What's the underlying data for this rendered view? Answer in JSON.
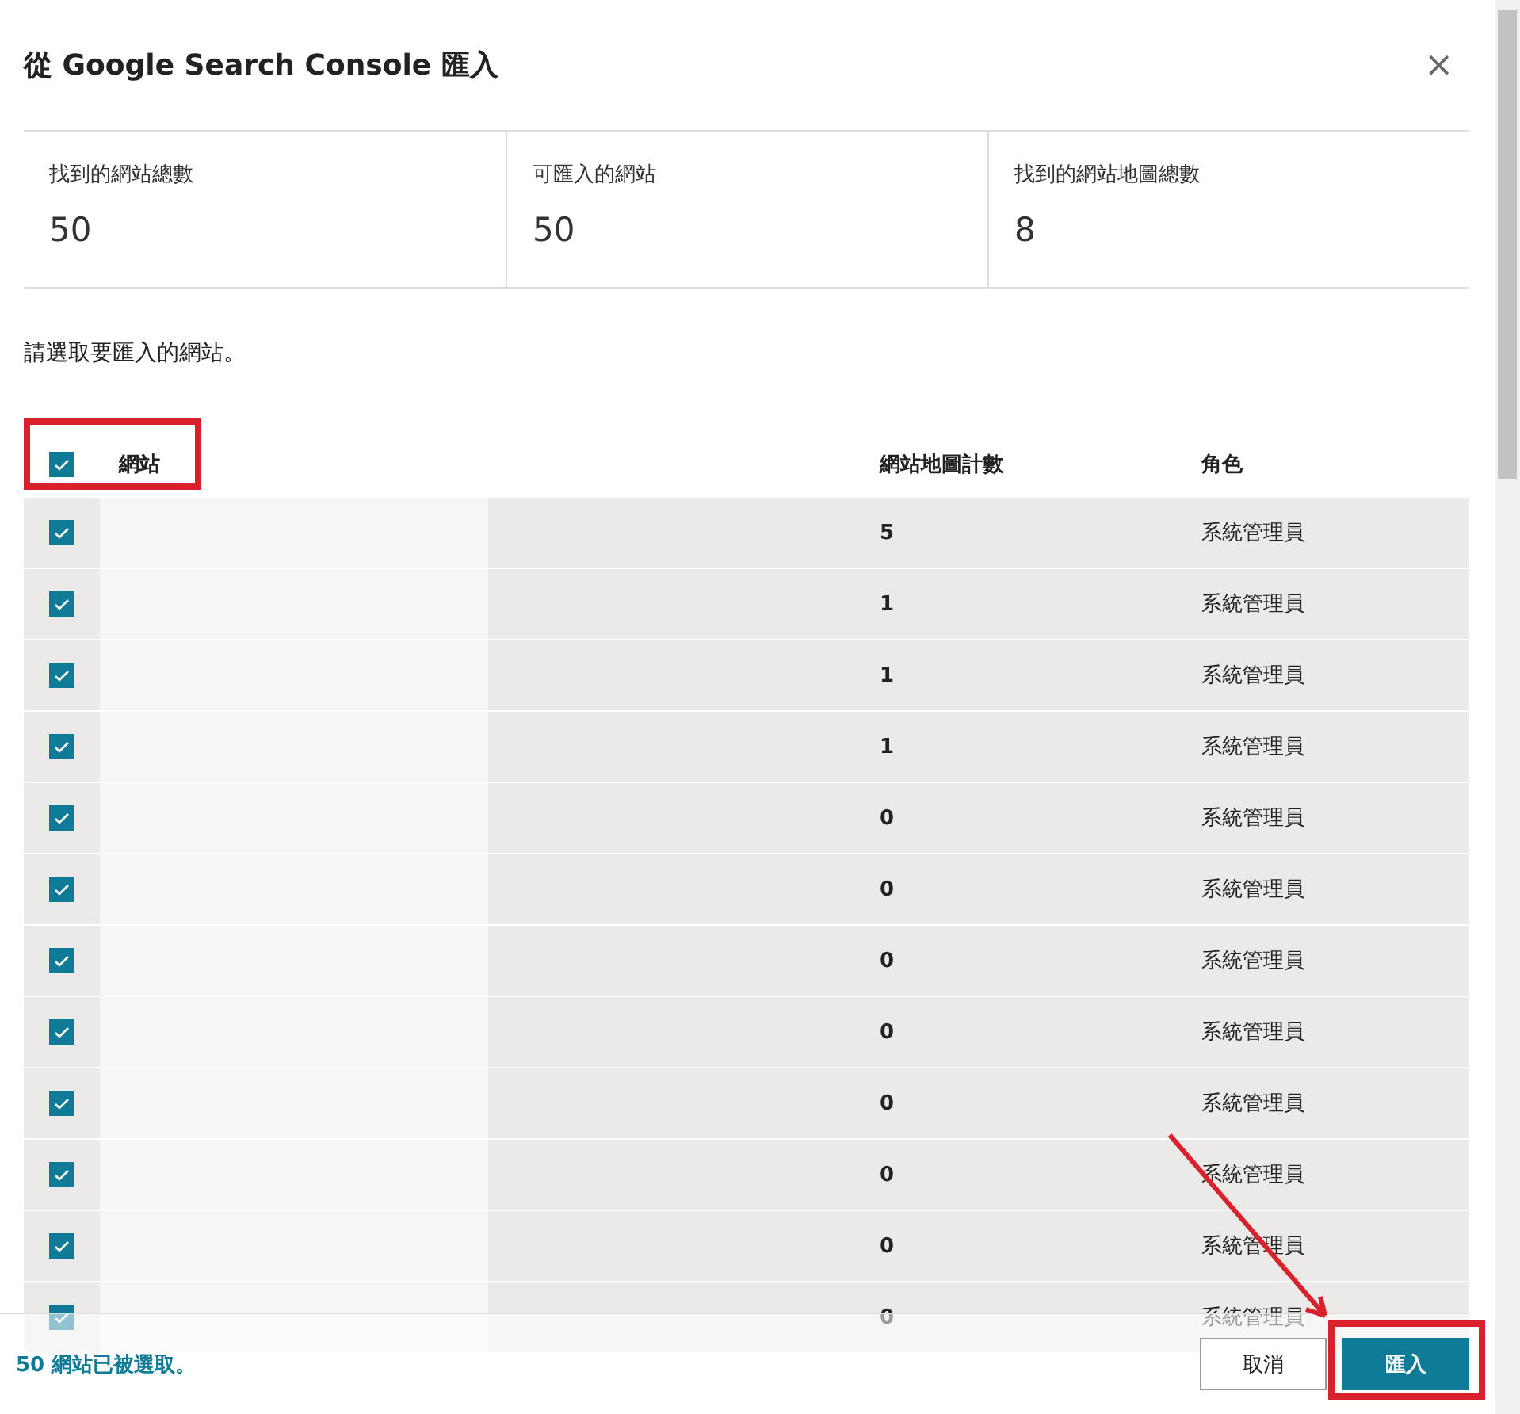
{
  "dialog": {
    "title": "從 Google Search Console 匯入",
    "close": "×"
  },
  "stats": [
    {
      "label": "找到的網站總數",
      "value": "50"
    },
    {
      "label": "可匯入的網站",
      "value": "50"
    },
    {
      "label": "找到的網站地圖總數",
      "value": "8"
    }
  ],
  "instruction": "請選取要匯入的網站。",
  "table": {
    "select_all": {
      "checked": true
    },
    "columns": [
      "網站",
      "網站地圖計數",
      "角色"
    ],
    "rows": [
      {
        "checked": true,
        "sitemaps": "5",
        "role": "系統管理員"
      },
      {
        "checked": true,
        "sitemaps": "1",
        "role": "系統管理員"
      },
      {
        "checked": true,
        "sitemaps": "1",
        "role": "系統管理員"
      },
      {
        "checked": true,
        "sitemaps": "1",
        "role": "系統管理員"
      },
      {
        "checked": true,
        "sitemaps": "0",
        "role": "系統管理員"
      },
      {
        "checked": true,
        "sitemaps": "0",
        "role": "系統管理員"
      },
      {
        "checked": true,
        "sitemaps": "0",
        "role": "系統管理員"
      },
      {
        "checked": true,
        "sitemaps": "0",
        "role": "系統管理員"
      },
      {
        "checked": true,
        "sitemaps": "0",
        "role": "系統管理員"
      },
      {
        "checked": true,
        "sitemaps": "0",
        "role": "系統管理員"
      },
      {
        "checked": true,
        "sitemaps": "0",
        "role": "系統管理員"
      },
      {
        "checked": true,
        "sitemaps": "0",
        "role": "系統管理員"
      }
    ]
  },
  "footer": {
    "status": "50 網站已被選取。",
    "buttons": [
      {
        "label": "取消",
        "kind": "secondary"
      },
      {
        "label": "匯入",
        "kind": "primary"
      }
    ]
  }
}
